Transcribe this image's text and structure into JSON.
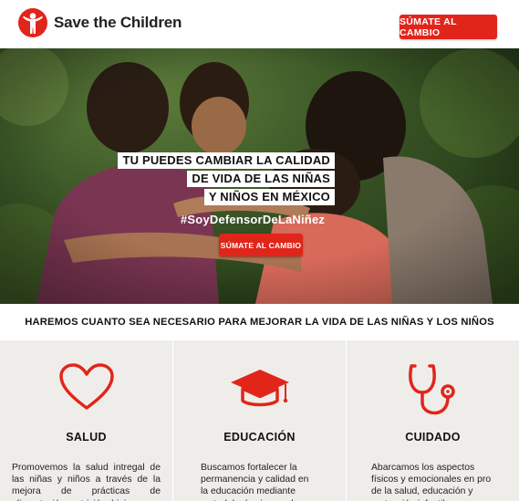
{
  "brand": {
    "name": "Save the Children",
    "accent_color": "#e1251b",
    "logo_icon": "child-silhouette-icon"
  },
  "header": {
    "cta_label": "SÚMATE AL CAMBIO"
  },
  "hero": {
    "headline_lines": [
      "TU PUEDES CAMBIAR LA CALIDAD",
      "DE VIDA DE LAS NIÑAS",
      "Y NIÑOS EN MÉXICO"
    ],
    "hashtag": "#SoyDefensorDeLaNiñez",
    "cta_label": "SÚMATE AL CAMBIO"
  },
  "tagline": "HAREMOS CUANTO SEA NECESARIO PARA MEJORAR LA VIDA DE LAS NIÑAS Y LOS NIÑOS",
  "cards": [
    {
      "icon": "heart-icon",
      "title": "SALUD",
      "text": "Promovemos la salud intregal de las niñas y niños a través de la mejora de prácticas de alimentación, nutrición, higiene y"
    },
    {
      "icon": "graduation-cap-icon",
      "title": "EDUCACIÓN",
      "text": "Buscamos fortalecer la permanencia y calidad en la educación mediante metodologías innovadoras"
    },
    {
      "icon": "stethoscope-icon",
      "title": "CUIDADO",
      "text": "Abarcamos los aspectos físicos y emocionales en pro de la salud, educación y protección infantil"
    }
  ]
}
